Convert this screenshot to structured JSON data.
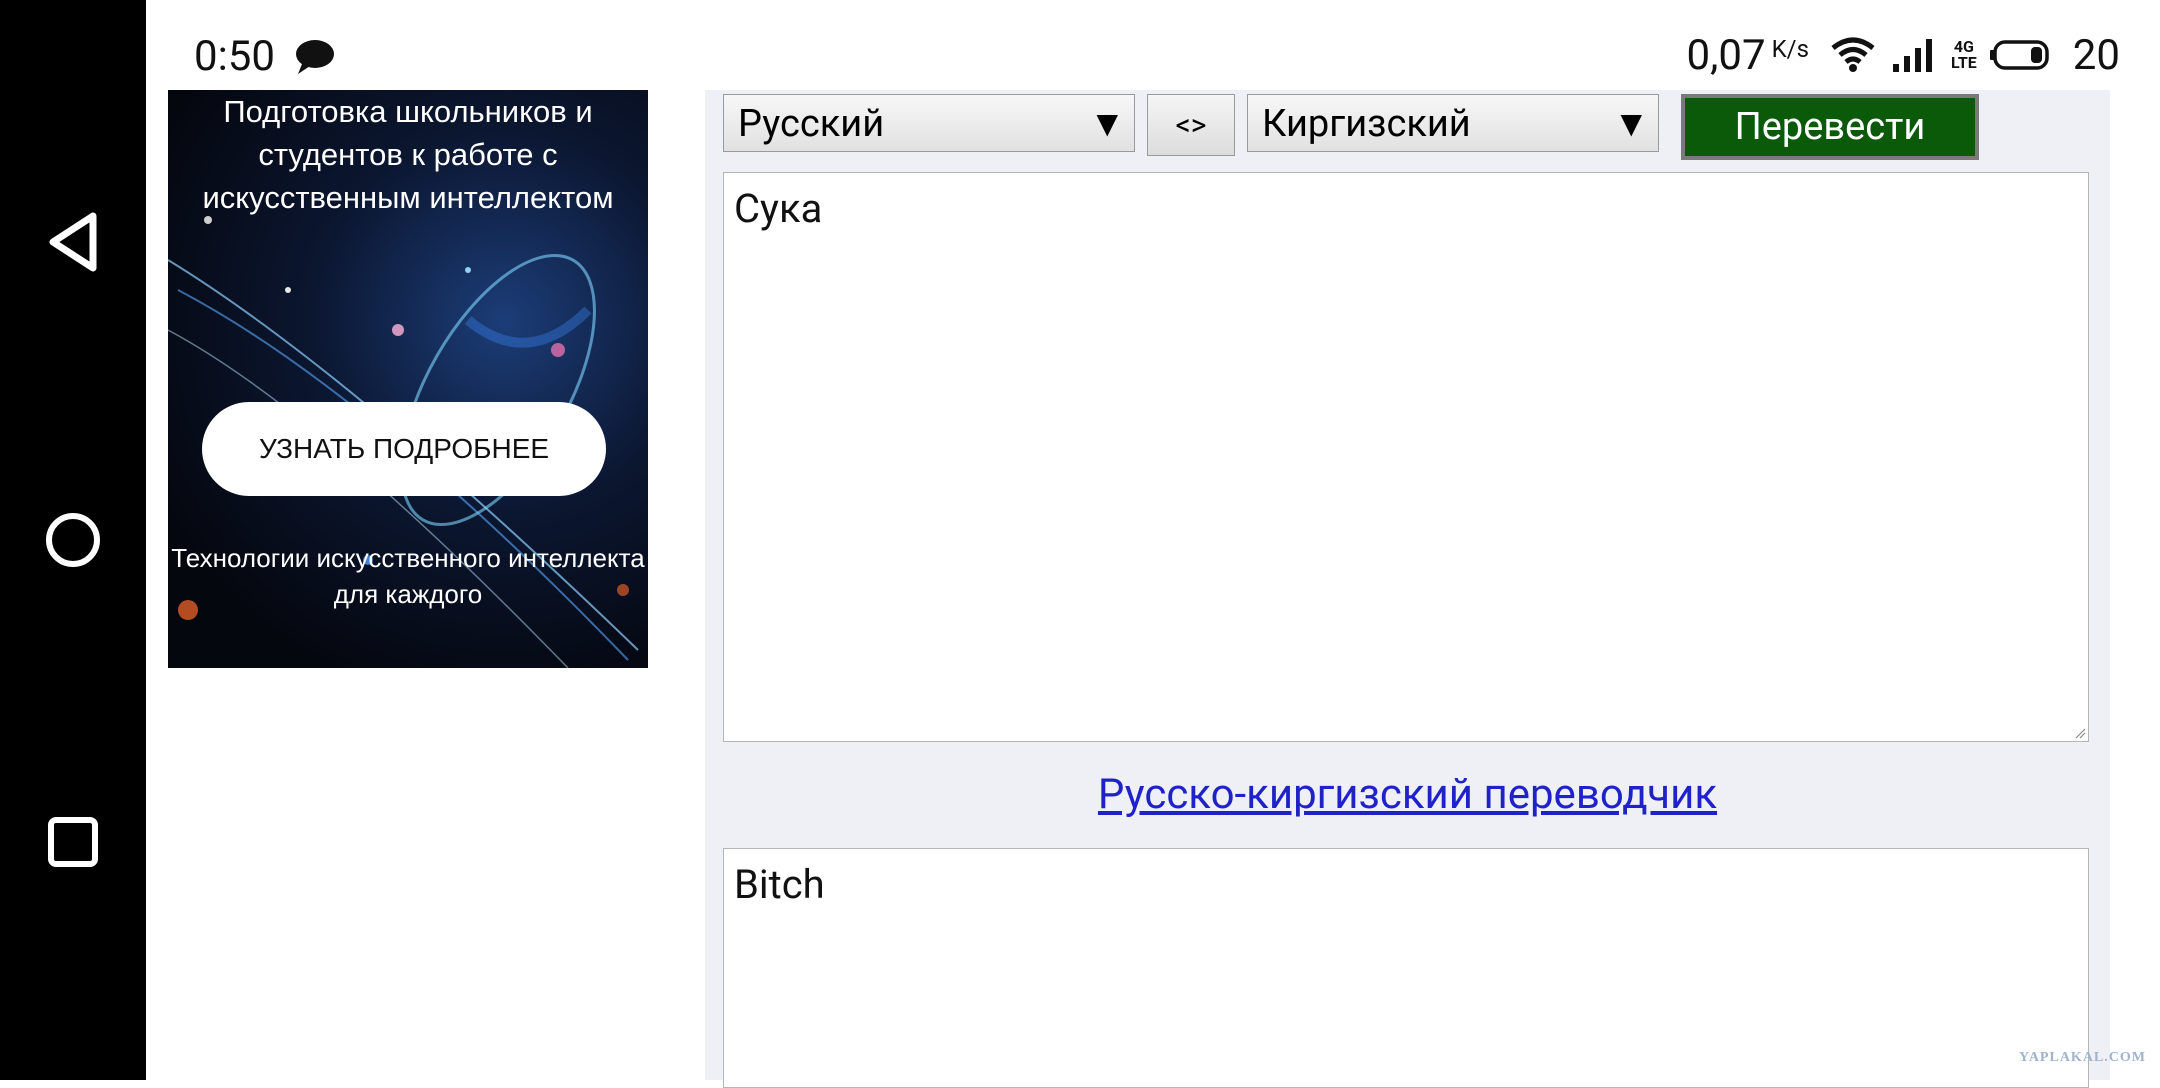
{
  "status_bar": {
    "time": "0:50",
    "net_speed": "0,07",
    "net_unit": "K/s",
    "network_type_top": "4G",
    "network_type_bottom": "LTE",
    "battery": "20"
  },
  "navigation_bar": {
    "icons": [
      "back-icon",
      "home-icon",
      "recents-icon"
    ]
  },
  "ad": {
    "headline": "Подготовка школьников и студентов к работе с искусственным интеллектом",
    "button_label": "УЗНАТЬ ПОДРОБНЕЕ",
    "footer": "Технологии искусственного интеллекта для каждого"
  },
  "translator": {
    "source_language": "Русский",
    "swap_label": "<>",
    "target_language": "Киргизский",
    "translate_button": "Перевести",
    "source_text": "Сука",
    "title_link": "Русско-киргизский переводчик",
    "result_text": "Bitch"
  },
  "watermark": "YAPLAKAL.COM",
  "colors": {
    "translate_button_bg": "#0a5a0a",
    "link": "#1f22c8",
    "panel_bg": "#eef0f6"
  }
}
